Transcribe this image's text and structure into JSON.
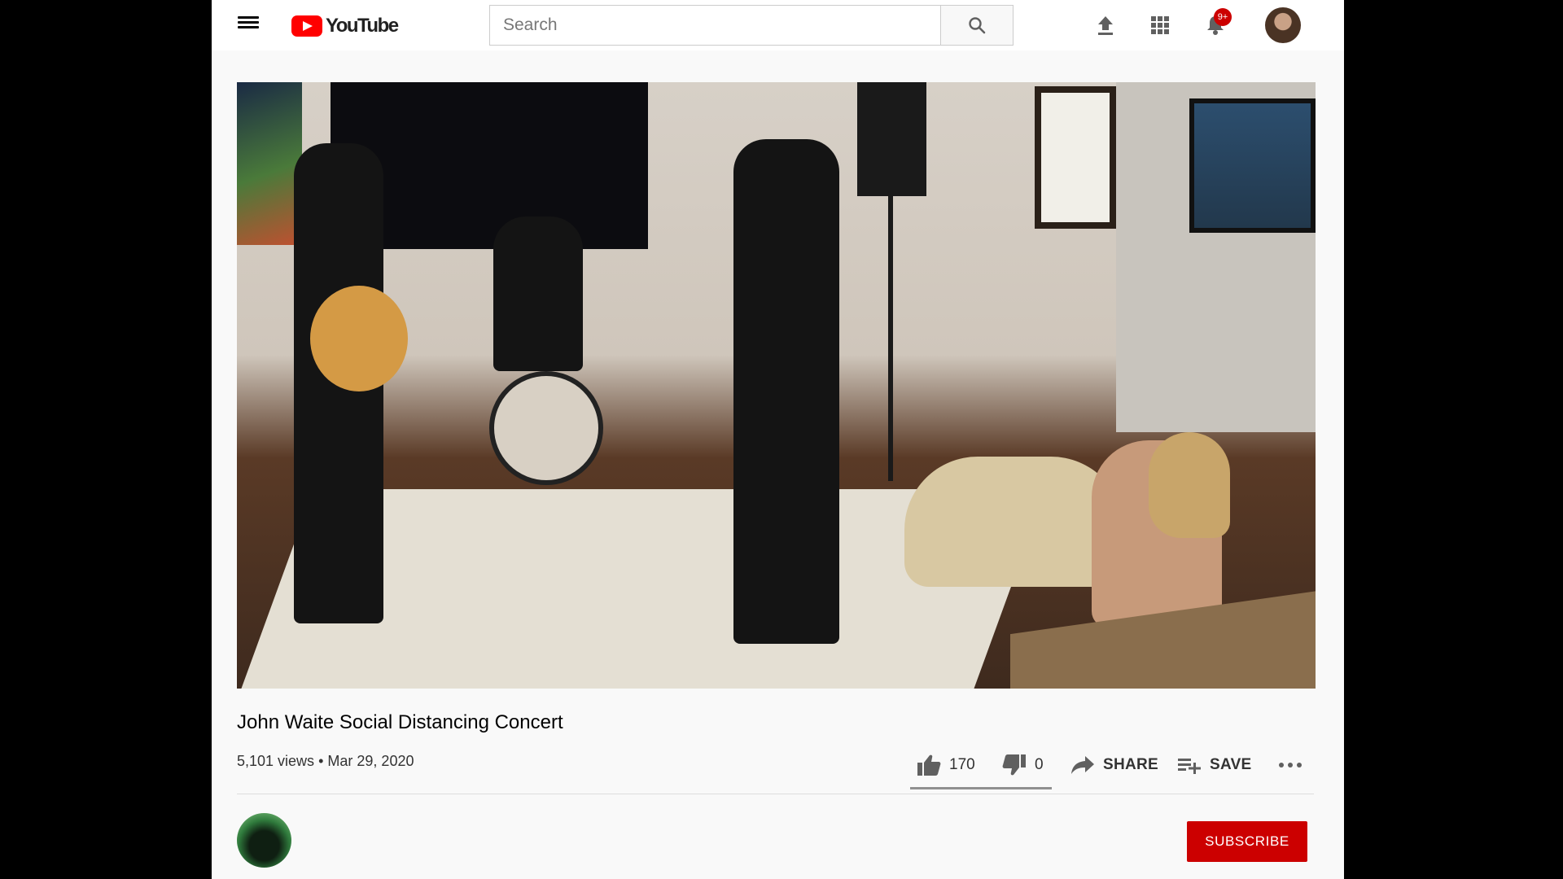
{
  "header": {
    "logo_text": "YouTube",
    "search": {
      "placeholder": "Search",
      "value": ""
    },
    "notification_count": "9+",
    "icons": [
      "menu-icon",
      "search-icon",
      "upload-icon",
      "apps-icon",
      "bell-icon"
    ]
  },
  "video": {
    "title": "John Waite Social Distancing Concert",
    "views": "5,101 views",
    "separator": "•",
    "date": "Mar 29, 2020"
  },
  "actions": {
    "likes": "170",
    "dislikes": "0",
    "share_label": "SHARE",
    "save_label": "SAVE",
    "like_ratio": 1.0
  },
  "channel": {
    "subscribe_label": "SUBSCRIBE"
  },
  "colors": {
    "brand_red": "#ff0000",
    "subscribe_red": "#cc0000",
    "icon_gray": "#606060"
  }
}
